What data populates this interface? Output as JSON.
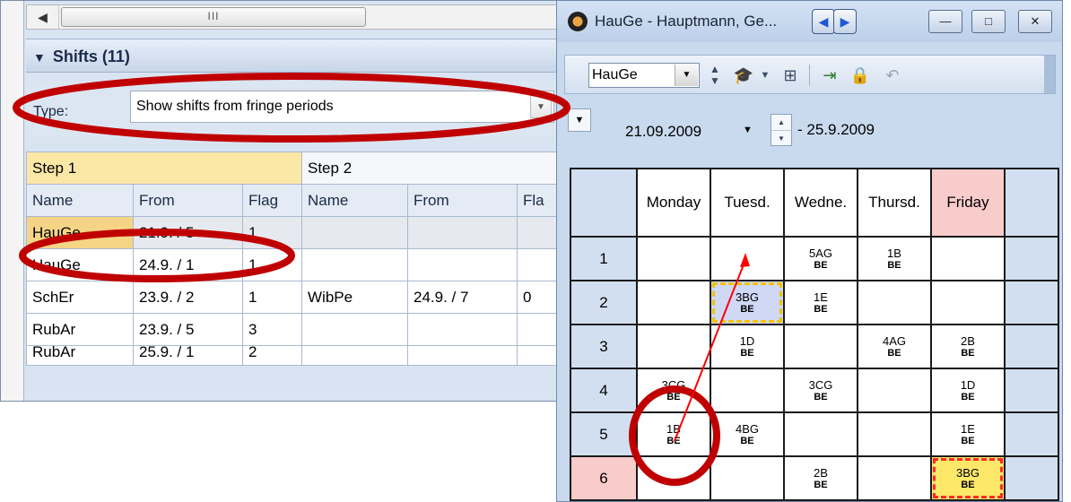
{
  "left_panel": {
    "scroll_grip": "III",
    "scroll_left_arrow": "◀",
    "shifts_title": "Shifts (11)",
    "shifts_collapse_icon": "▼",
    "type_label": "Type:",
    "type_value": "Show shifts from fringe periods",
    "type_dropdown_icon": "▼",
    "grid": {
      "group_headers": [
        "Step 1",
        "Step 2"
      ],
      "columns": [
        "Name",
        "From",
        "Flag",
        "Name",
        "From",
        "Fla"
      ],
      "rows": [
        [
          "HauGe",
          "21.9. / 5",
          "1",
          "",
          "",
          ""
        ],
        [
          "HauGe",
          "24.9. / 1",
          "1",
          "",
          "",
          ""
        ],
        [
          "SchEr",
          "23.9. / 2",
          "1",
          "WibPe",
          "24.9. / 7",
          "0"
        ],
        [
          "RubAr",
          "23.9. / 5",
          "3",
          "",
          "",
          ""
        ],
        [
          "RubAr",
          "25.9. / 1",
          "2",
          "",
          "",
          ""
        ]
      ]
    }
  },
  "window": {
    "title": "HauGe - Hauptmann, Ge...",
    "nav_prev": "◀",
    "nav_next": "▶",
    "minimize": "—",
    "maximize": "□",
    "close": "✕",
    "teacher_value": "HauGe",
    "combo_arrow": "▼",
    "collapse_arrow": "▼",
    "date_from": "21.09.2009",
    "date_to": "- 25.9.2009",
    "spin_up": "▲",
    "spin_down": "▼",
    "icons": [
      "spin-icon",
      "teacher-hat-icon",
      "dropdown-icon",
      "grid-icon",
      "export-icon",
      "lock-icon",
      "undo-icon"
    ]
  },
  "timetable": {
    "days": [
      "Monday",
      "Tuesd.",
      "Wedne.",
      "Thursd.",
      "Friday"
    ],
    "periods": [
      "1",
      "2",
      "3",
      "4",
      "5",
      "6"
    ],
    "cells": [
      [
        [
          "",
          ""
        ],
        [
          "",
          ""
        ],
        [
          "5AG",
          "BE"
        ],
        [
          "1B",
          "BE"
        ],
        [
          "",
          ""
        ]
      ],
      [
        [
          "",
          ""
        ],
        [
          "3BG",
          "BE"
        ],
        [
          "1E",
          "BE"
        ],
        [
          "",
          ""
        ],
        [
          "",
          ""
        ]
      ],
      [
        [
          "",
          ""
        ],
        [
          "1D",
          "BE"
        ],
        [
          "",
          ""
        ],
        [
          "4AG",
          "BE"
        ],
        [
          "2B",
          "BE"
        ]
      ],
      [
        [
          "3CG",
          "BE"
        ],
        [
          "",
          ""
        ],
        [
          "3CG",
          "BE"
        ],
        [
          "",
          ""
        ],
        [
          "1D",
          "BE"
        ]
      ],
      [
        [
          "1B",
          "BE"
        ],
        [
          "4BG",
          "BE"
        ],
        [
          "",
          ""
        ],
        [
          "",
          ""
        ],
        [
          "1E",
          "BE"
        ]
      ],
      [
        [
          "",
          ""
        ],
        [
          "",
          ""
        ],
        [
          "2B",
          "BE"
        ],
        [
          "",
          ""
        ],
        [
          "3BG",
          "BE"
        ]
      ]
    ]
  },
  "colors": {
    "annotation_red": "#c00000",
    "arrow_red": "#ff0000",
    "highlight_pink": "#f9cccc",
    "selected_gold": "#f5d486"
  }
}
